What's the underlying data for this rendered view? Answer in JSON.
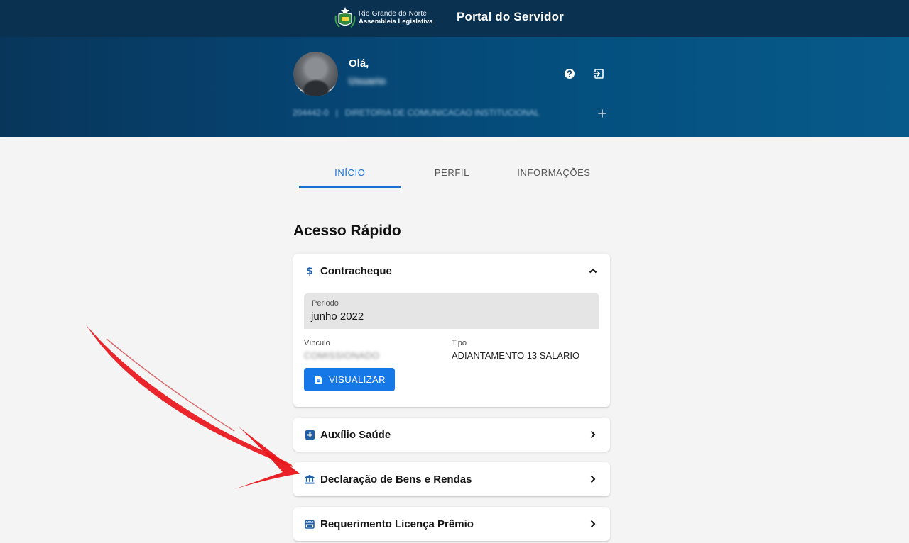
{
  "header": {
    "logo": {
      "line1": "Rio Grande do Norte",
      "line2": "Assembleia Legislativa"
    },
    "title": "Portal do Servidor"
  },
  "profile": {
    "greeting": "Olá,",
    "name": "Usuario",
    "registration": "204442-0",
    "separator": "|",
    "department": "DIRETORIA DE COMUNICACAO INSTITUCIONAL"
  },
  "tabs": [
    {
      "label": "INÍCIO",
      "active": true
    },
    {
      "label": "PERFIL",
      "active": false
    },
    {
      "label": "INFORMAÇÕES",
      "active": false
    }
  ],
  "quick_access": {
    "title": "Acesso Rápido",
    "contracheque": {
      "title": "Contracheque",
      "period_label": "Periodo",
      "period_value": "junho 2022",
      "vinculo_label": "Vínculo",
      "vinculo_value": "COMISSIONADO",
      "tipo_label": "Tipo",
      "tipo_value": "ADIANTAMENTO 13 SALARIO",
      "button_label": "VISUALIZAR"
    },
    "items": [
      {
        "title": "Auxílio Saúde"
      },
      {
        "title": "Declaração de Bens e Rendas"
      },
      {
        "title": "Requerimento Licença Prêmio"
      }
    ]
  },
  "colors": {
    "topbar": "#0a3150",
    "accent": "#1677e6",
    "tab_active": "#1a6fd1",
    "annotation_arrow": "#e8141a"
  }
}
